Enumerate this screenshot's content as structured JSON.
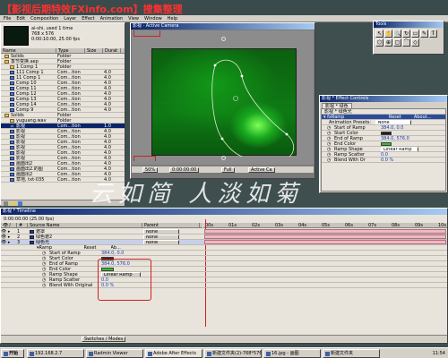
{
  "banner": "【影视后期特效FXinfo.com】搜集整理",
  "app_title": "Adobe After Effects",
  "menu": [
    "File",
    "Edit",
    "Composition",
    "Layer",
    "Effect",
    "Animation",
    "View",
    "Window",
    "Help"
  ],
  "project": {
    "comp_name": "ai-shi",
    "comp_used": "used 1 time",
    "comp_size": "768 x 576",
    "comp_info": "0:00:10:00, 25.00 fps",
    "columns": [
      "Name",
      "Type",
      "Size",
      "Durat"
    ],
    "items": [
      {
        "name": "Solids",
        "type": "Folder",
        "size": "",
        "dur": ""
      },
      {
        "name": "季节变换.aep",
        "type": "Folder",
        "size": "",
        "dur": ""
      },
      {
        "name": "1 Comp 1",
        "type": "Folder",
        "size": "",
        "dur": ""
      },
      {
        "name": "111 Comp 1",
        "type": "Com...tion",
        "size": "",
        "dur": "4.0"
      },
      {
        "name": "11 Comp 1",
        "type": "Com...tion",
        "size": "",
        "dur": "4.0"
      },
      {
        "name": "Comp 10",
        "type": "Com...tion",
        "size": "",
        "dur": "4.0"
      },
      {
        "name": "Comp 11",
        "type": "Com...tion",
        "size": "",
        "dur": "4.0"
      },
      {
        "name": "Comp 12",
        "type": "Com...tion",
        "size": "",
        "dur": "4.0"
      },
      {
        "name": "Comp 13",
        "type": "Com...tion",
        "size": "",
        "dur": "4.0"
      },
      {
        "name": "Comp 14",
        "type": "Com...tion",
        "size": "",
        "dur": "4.0"
      },
      {
        "name": "Comp 9",
        "type": "Com...tion",
        "size": "",
        "dur": "4.0"
      },
      {
        "name": "Solids",
        "type": "Folder",
        "size": "",
        "dur": ""
      },
      {
        "name": "yuguang.wav",
        "type": "Folder",
        "size": "",
        "dur": ""
      },
      {
        "name": "影视",
        "type": "Com...tion",
        "size": "",
        "dur": "1.0"
      },
      {
        "name": "影视",
        "type": "Com...tion",
        "size": "",
        "dur": "4.0"
      },
      {
        "name": "影视",
        "type": "Com...tion",
        "size": "",
        "dur": "4.0"
      },
      {
        "name": "影视",
        "type": "Com...tion",
        "size": "",
        "dur": "4.0"
      },
      {
        "name": "影视",
        "type": "Com...tion",
        "size": "",
        "dur": "4.0"
      },
      {
        "name": "影视",
        "type": "Com...tion",
        "size": "",
        "dur": "4.0"
      },
      {
        "name": "影视",
        "type": "Com...tion",
        "size": "",
        "dur": "4.0"
      },
      {
        "name": "画面出2",
        "type": "Com...tion",
        "size": "",
        "dur": "4.0"
      },
      {
        "name": "画面出2.的图",
        "type": "Com...tion",
        "size": "",
        "dur": "4.0"
      },
      {
        "name": "画面出2",
        "type": "Com...tion",
        "size": "",
        "dur": "4.0"
      },
      {
        "name": "草地, txt-035",
        "type": "Com...tion",
        "size": "",
        "dur": "4.0"
      }
    ]
  },
  "comp_window": {
    "title": "影视 · Active Camera",
    "zoom": "50%",
    "timecode": "0:00:00:00",
    "resolution": "Full",
    "camera": "Active Ca"
  },
  "tools": {
    "title": "Tools",
    "items": [
      "↖",
      "✋",
      "🔍",
      "↻",
      "▭",
      "✎",
      "T",
      "⬡",
      "⊕",
      "▢",
      "⌒",
      "◇"
    ]
  },
  "effect_controls": {
    "title": "影视 * Effect Controls",
    "layer_tab": "影视 * 绿色",
    "layer_name": "影视 * 绿色光",
    "effect_name": "Ramp",
    "reset_label": "Reset",
    "about_label": "About...",
    "presets_label": "Animation Presets:",
    "presets_value": "None",
    "props": [
      {
        "name": "Start of Ramp",
        "value": "384.0, 0.0"
      },
      {
        "name": "Start Color",
        "value": ""
      },
      {
        "name": "End of Ramp",
        "value": "384.0, 576.0"
      },
      {
        "name": "End Color",
        "value": ""
      },
      {
        "name": "Ramp Shape",
        "value": "Linear Ramp"
      },
      {
        "name": "Ramp Scatter",
        "value": "0.0"
      },
      {
        "name": "Blend With Or",
        "value": "0.0 %"
      }
    ]
  },
  "watermark": "云如简 人淡如菊",
  "timeline": {
    "title": "影视 * Timeline",
    "timecode": "0:00:00:00 (25.00 fps)",
    "columns": [
      "#",
      "Source Name",
      "Parent"
    ],
    "layers": [
      {
        "num": "1",
        "name": "遮罩",
        "parent": "None"
      },
      {
        "num": "2",
        "name": "绿色遮2",
        "parent": "None"
      },
      {
        "num": "3",
        "name": "绿色光",
        "parent": "None"
      }
    ],
    "effect_group": "Ramp",
    "reset": "Reset",
    "about": "Ab...",
    "props": [
      {
        "name": "Start of Ramp",
        "value": "384.0, 0.0"
      },
      {
        "name": "Start Color",
        "value": ""
      },
      {
        "name": "End of Ramp",
        "value": "384.0, 576.0"
      },
      {
        "name": "End Color",
        "value": ""
      },
      {
        "name": "Ramp Shape",
        "value": "Linear Ramp"
      },
      {
        "name": "Ramp Scatter",
        "value": "0.0"
      },
      {
        "name": "Blend With Original",
        "value": "0.0 %"
      }
    ],
    "ruler": [
      "00s",
      "01s",
      "02s",
      "03s",
      "04s",
      "05s",
      "06s",
      "07s",
      "08s",
      "09s",
      "10s"
    ],
    "switches_label": "Switches / Modes"
  },
  "taskbar": {
    "start": "开始",
    "buttons": [
      "192.168.2.7",
      "Radmin Viewer",
      "Adobe After Effects",
      "新建文件夹(2)-768*576",
      "16.jpg - 画图",
      "新建文件夹"
    ],
    "clock": "11:54"
  },
  "colors": {
    "accent_red": "#d02020",
    "timeline_bar": "#f0b8c0",
    "title_blue": "#0a246a"
  }
}
